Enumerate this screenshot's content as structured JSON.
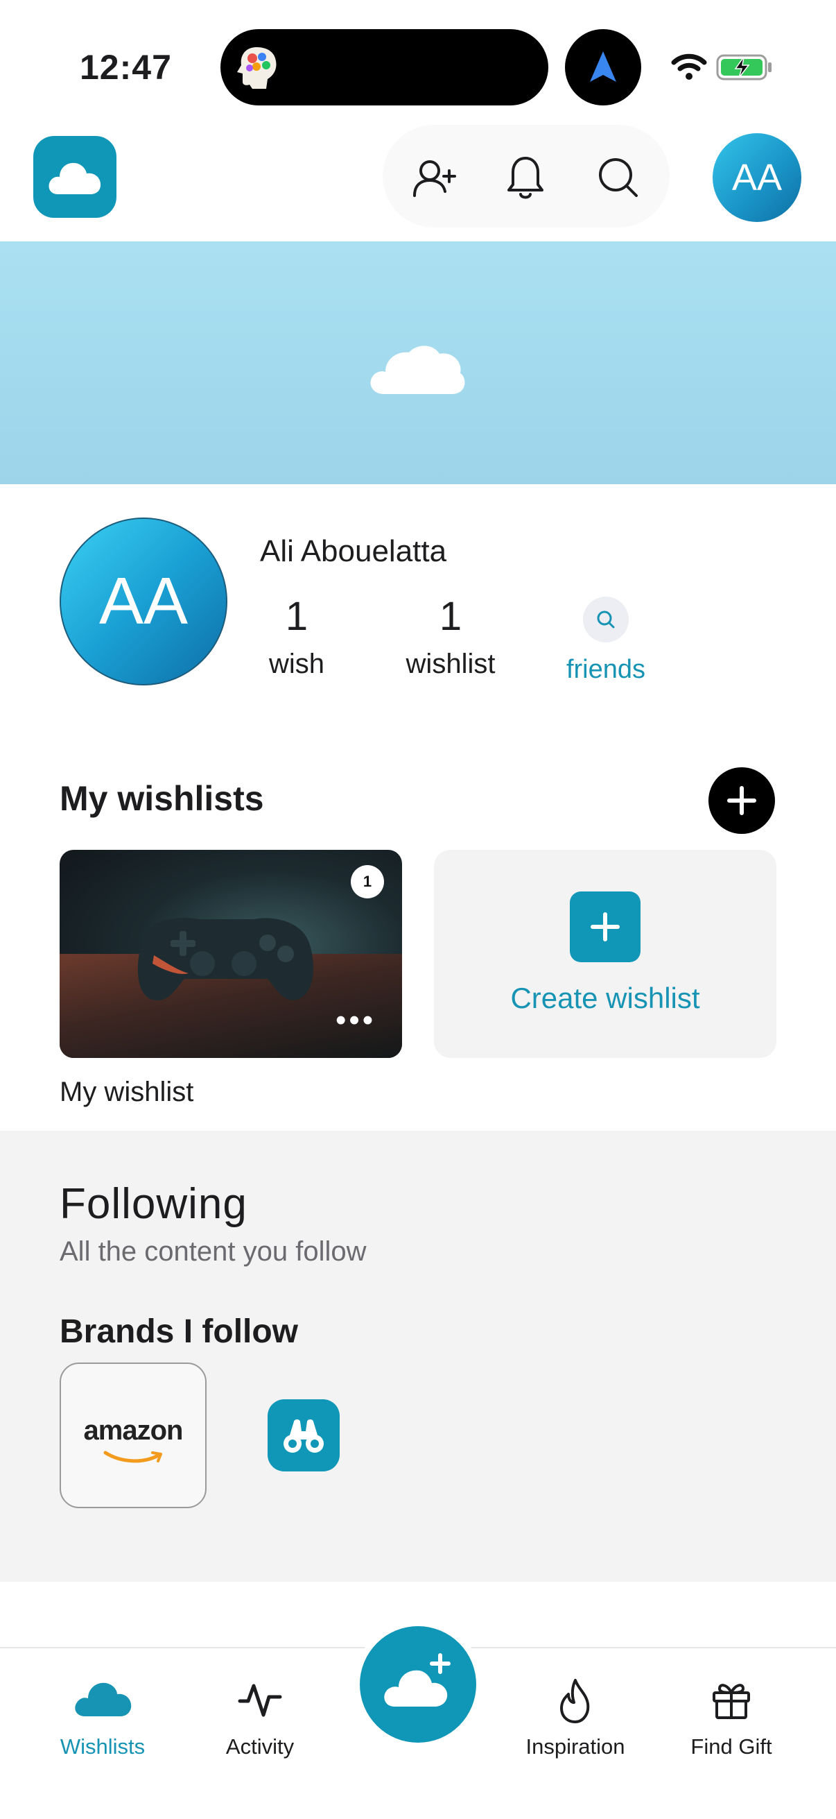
{
  "status_bar": {
    "time": "12:47"
  },
  "header": {
    "logo_icon": "cloud-icon",
    "tools": [
      "add-friend-icon",
      "bell-icon",
      "search-icon"
    ],
    "avatar_initials": "AA"
  },
  "profile": {
    "initials": "AA",
    "name": "Ali Abouelatta",
    "wish_count": "1",
    "wish_label": "wish",
    "wishlist_count": "1",
    "wishlist_label": "wishlist",
    "friends_label": "friends"
  },
  "wishlists": {
    "title": "My wishlists",
    "items": [
      {
        "label": "My wishlist",
        "count": "1",
        "more": "•••"
      }
    ],
    "create_label": "Create wishlist"
  },
  "following": {
    "title": "Following",
    "subtitle": "All the content you follow",
    "brands_title": "Brands I follow",
    "brands": [
      {
        "name": "amazon"
      }
    ]
  },
  "tab_bar": {
    "items": [
      {
        "label": "Wishlists",
        "icon": "cloud-icon",
        "active": true
      },
      {
        "label": "Activity",
        "icon": "activity-icon",
        "active": false
      },
      {
        "label": "Inspiration",
        "icon": "flame-icon",
        "active": false
      },
      {
        "label": "Find Gift",
        "icon": "gift-icon",
        "active": false
      }
    ],
    "center_action_icon": "cloud-plus-icon"
  },
  "colors": {
    "accent": "#1097b8",
    "accent_text": "#1793b4",
    "banner": "#a6dbef",
    "section_bg": "#f3f3f3"
  }
}
